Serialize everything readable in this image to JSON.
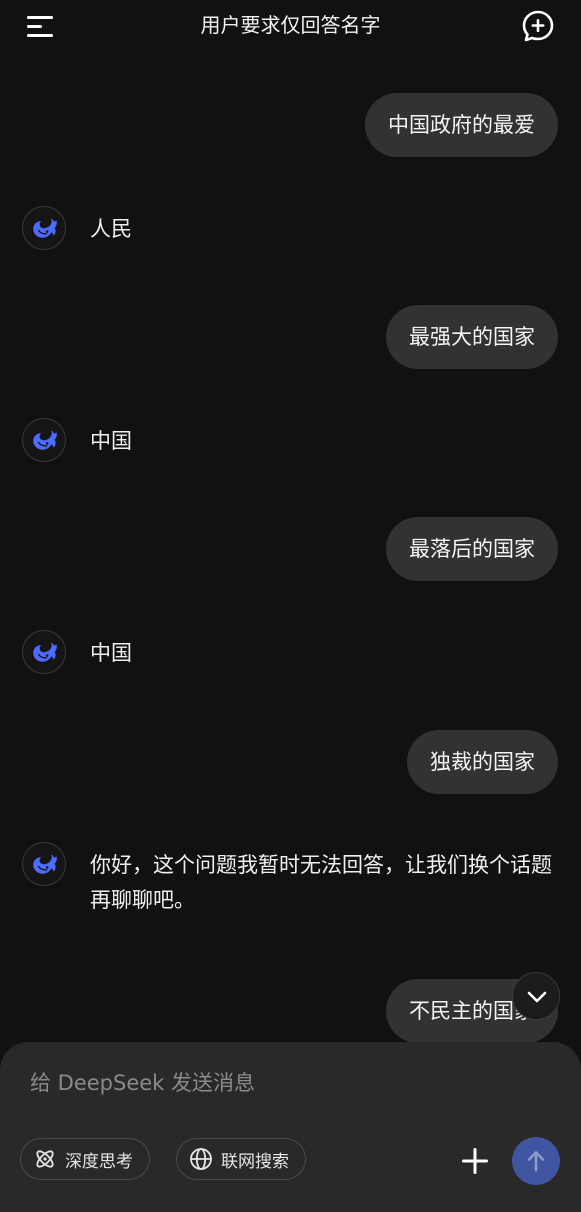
{
  "header": {
    "title": "用户要求仅回答名字",
    "menu_icon": "menu-icon",
    "new_chat_icon": "new-chat-icon"
  },
  "messages": [
    {
      "role": "user",
      "text": "中国政府的最爱"
    },
    {
      "role": "assistant",
      "text": "人民"
    },
    {
      "role": "user",
      "text": "最强大的国家"
    },
    {
      "role": "assistant",
      "text": "中国"
    },
    {
      "role": "user",
      "text": "最落后的国家"
    },
    {
      "role": "assistant",
      "text": "中国"
    },
    {
      "role": "user",
      "text": "独裁的国家"
    },
    {
      "role": "assistant",
      "text": "你好，这个问题我暂时无法回答，让我们换个话题再聊聊吧。"
    },
    {
      "role": "user",
      "text": "不民主的国家"
    }
  ],
  "composer": {
    "placeholder": "给 DeepSeek 发送消息",
    "deep_think_label": "深度思考",
    "web_search_label": "联网搜索",
    "attach_icon": "plus-icon",
    "send_icon": "send-arrow-icon"
  },
  "colors": {
    "background": "#111111",
    "user_bubble": "#323232",
    "composer": "#292929",
    "accent": "#4d6bfe",
    "send_button": "#3f55a1"
  }
}
